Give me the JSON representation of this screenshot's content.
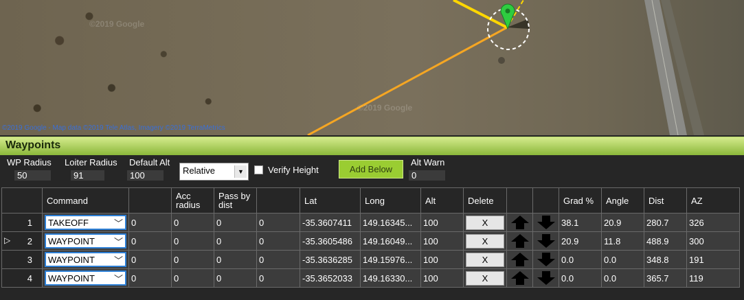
{
  "map": {
    "copyright": "©2019 Google - Map data ©2019 Tele Atlas, Imagery ©2019 TerraMetrics",
    "watermark": "©2019 Google"
  },
  "panel": {
    "title": "Waypoints"
  },
  "controls": {
    "wp_radius_label": "WP Radius",
    "wp_radius_value": "50",
    "loiter_radius_label": "Loiter Radius",
    "loiter_radius_value": "91",
    "default_alt_label": "Default Alt",
    "default_alt_value": "100",
    "alt_frame_value": "Relative",
    "verify_height_label": "Verify Height",
    "add_below_label": "Add Below",
    "alt_warn_label": "Alt Warn",
    "alt_warn_value": "0"
  },
  "table": {
    "headers": {
      "command": "Command",
      "p1": "",
      "acc_radius": "Acc radius",
      "pass_by_dist": "Pass by dist",
      "p4": "",
      "lat": "Lat",
      "long": "Long",
      "alt": "Alt",
      "delete": "Delete",
      "up": "",
      "down": "",
      "grad": "Grad %",
      "angle": "Angle",
      "dist": "Dist",
      "az": "AZ"
    },
    "rows": [
      {
        "idx": "1",
        "command": "TAKEOFF",
        "p1": "0",
        "p2": "0",
        "p3": "0",
        "p4": "0",
        "lat": "-35.3607411",
        "long": "149.16345...",
        "alt": "100",
        "delete": "X",
        "grad": "38.1",
        "angle": "20.9",
        "dist": "280.7",
        "az": "326"
      },
      {
        "idx": "2",
        "command": "WAYPOINT",
        "p1": "0",
        "p2": "0",
        "p3": "0",
        "p4": "0",
        "lat": "-35.3605486",
        "long": "149.16049...",
        "alt": "100",
        "delete": "X",
        "grad": "20.9",
        "angle": "11.8",
        "dist": "488.9",
        "az": "300"
      },
      {
        "idx": "3",
        "command": "WAYPOINT",
        "p1": "0",
        "p2": "0",
        "p3": "0",
        "p4": "0",
        "lat": "-35.3636285",
        "long": "149.15976...",
        "alt": "100",
        "delete": "X",
        "grad": "0.0",
        "angle": "0.0",
        "dist": "348.8",
        "az": "191"
      },
      {
        "idx": "4",
        "command": "WAYPOINT",
        "p1": "0",
        "p2": "0",
        "p3": "0",
        "p4": "0",
        "lat": "-35.3652033",
        "long": "149.16330...",
        "alt": "100",
        "delete": "X",
        "grad": "0.0",
        "angle": "0.0",
        "dist": "365.7",
        "az": "119"
      }
    ],
    "current_row_marker": "▷",
    "icons": {
      "up": "arrow-up-icon",
      "down": "arrow-down-icon",
      "dropdown": "chevron-down-icon"
    }
  },
  "colors": {
    "accent_green": "#9acd32",
    "route_yellow": "#ffd700",
    "route_orange": "#f5a623",
    "marker_green": "#2ecc40",
    "selection_blue": "#2c7fd6"
  }
}
